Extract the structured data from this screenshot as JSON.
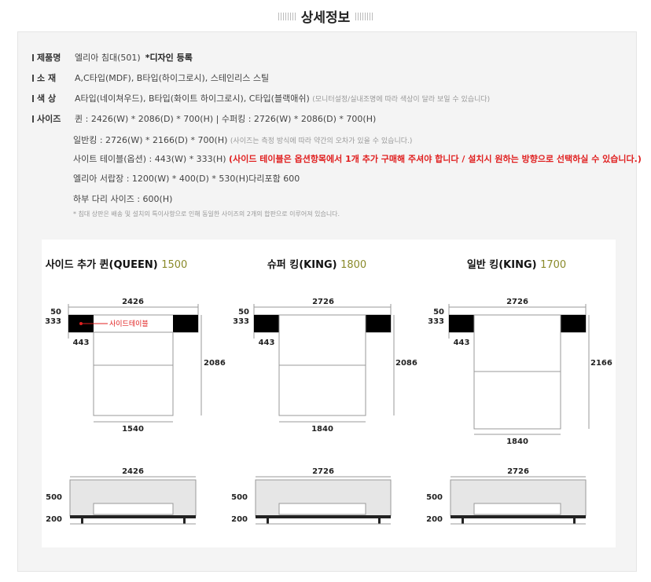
{
  "header": {
    "title": "상세정보"
  },
  "specs": {
    "name_label": "제품명",
    "name_value": "엘리아 침대(501)",
    "name_note": "*디자인 등록",
    "material_label": "소 재",
    "material_value": "A,C타입(MDF), B타입(하이그로시), 스테인리스 스틸",
    "color_label": "색 상",
    "color_value": "A타입(네이쳐우드), B타입(화이트 하이그로시), C타입(블랙애쉬)",
    "color_note": "(모니터설정/실내조명에 따라 색상이 달라 보일 수 있습니다)",
    "size_label": "사이즈",
    "size_value": "퀸 : 2426(W) * 2086(D) * 700(H)  |  수퍼킹 : 2726(W) * 2086(D) * 700(H)",
    "size_line2": "일반킹 : 2726(W) * 2166(D) * 700(H)",
    "size_line2_note": "(사이즈는 측정 방식에 따라 약간의 오차가 있을 수 있습니다.)",
    "size_line3": "사이트 테이블(옵션) : 443(W) * 333(H)",
    "size_line3_red": "(사이드 테이블은 옵션항목에서 1개 추가 구매해 주셔야 합니다 / 설치시 원하는 방향으로 선택하실 수 있습니다.)",
    "size_line4": "엘리아 서랍장 : 1200(W) * 400(D) * 530(H)다리포함 600",
    "size_line5": "하부 다리 사이즈 : 600(H)",
    "footnote": "* 침대 상판은 배송 및 설치의 특이사항으로 인해 동일한 사이즈의 2개의 합판으로 이루어져 있습니다."
  },
  "diagrams": [
    {
      "name": "사이드 추가 퀸(QUEEN)",
      "price": "1500",
      "width": "2426",
      "depth": "2086",
      "inner": "1540",
      "top": "50",
      "table_h": "333",
      "table_w": "443",
      "side_label": "사이드테이블",
      "front_h": "500",
      "leg_h": "200"
    },
    {
      "name": "슈퍼 킹(KING)",
      "price": "1800",
      "width": "2726",
      "depth": "2086",
      "inner": "1840",
      "top": "50",
      "table_h": "333",
      "table_w": "443",
      "front_h": "500",
      "leg_h": "200"
    },
    {
      "name": "일반 킹(KING)",
      "price": "1700",
      "width": "2726",
      "depth": "2166",
      "inner": "1840",
      "top": "50",
      "table_h": "333",
      "table_w": "443",
      "front_h": "500",
      "leg_h": "200"
    }
  ]
}
